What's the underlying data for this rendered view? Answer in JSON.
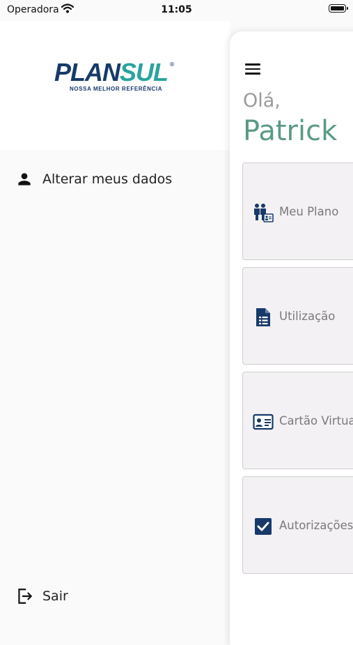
{
  "status_bar": {
    "carrier": "Operadora",
    "time": "11:05"
  },
  "drawer": {
    "logo": {
      "brand_part1": "PLAN",
      "brand_part2": "SUL",
      "registered": "®",
      "tagline": "NOSSA MELHOR REFERÊNCIA"
    },
    "items": [
      {
        "label": "Alterar meus dados",
        "icon": "person-icon"
      },
      {
        "label": "Sair",
        "icon": "logout-icon"
      }
    ]
  },
  "main": {
    "greeting": "Olá,",
    "username": "Patrick",
    "cards": [
      {
        "label": "Meu Plano",
        "icon": "family-plan-icon"
      },
      {
        "label": "Utilização",
        "icon": "document-list-icon"
      },
      {
        "label": "Cartão Virtual",
        "icon": "id-card-icon"
      },
      {
        "label": "Autorizações",
        "icon": "checkbox-icon"
      }
    ]
  },
  "colors": {
    "brand_navy": "#173a6a",
    "brand_teal": "#2aa49c",
    "name_green": "#5a9a86",
    "card_bg": "#f3f1f3"
  }
}
